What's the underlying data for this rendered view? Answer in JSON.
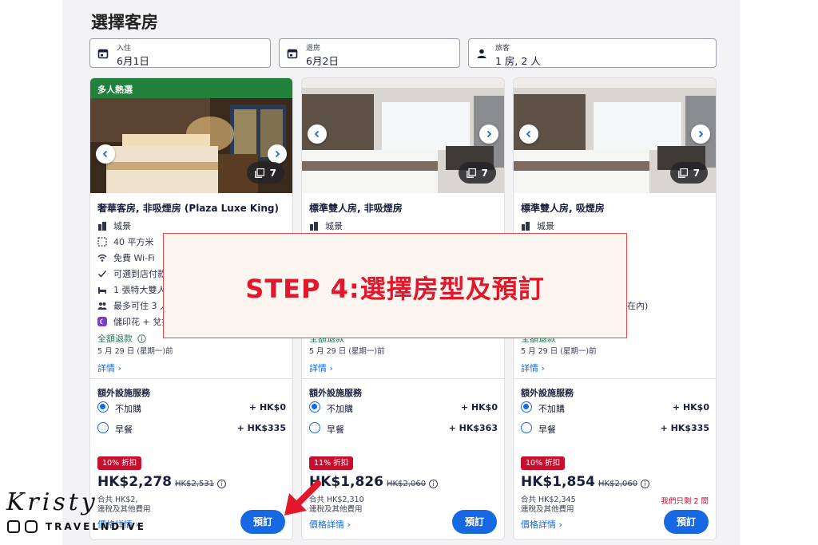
{
  "page_title": "選擇客房",
  "search": {
    "checkin": {
      "label": "入住",
      "value": "6月1日"
    },
    "checkout": {
      "label": "退房",
      "value": "6月2日"
    },
    "guests": {
      "label": "旅客",
      "value": "1 房, 2 人"
    }
  },
  "rooms": [
    {
      "badge": "多人熱選",
      "photo_count": "7",
      "name": "奢華客房, 非吸煙房 (Plaza Luxe King)",
      "features": [
        "城景",
        "40 平方米",
        "免費 Wi-Fi",
        "可選到店付款",
        "1 張特大雙人",
        "最多可住 3 人",
        "儲印花 + 兌換"
      ],
      "refund": "全額退款",
      "refund_date": "5 月 29 日 (星期一)前",
      "details": "詳情",
      "extras_title": "額外設施服務",
      "options": [
        {
          "label": "不加購",
          "price": "+ HK$0",
          "selected": true
        },
        {
          "label": "早餐",
          "price": "+ HK$335",
          "selected": false
        }
      ],
      "discount": "10% 折扣",
      "price": "HK$2,278",
      "original_price": "HK$2,531",
      "total": "合共 HK$2,  ",
      "tax_note": "連稅及其他費用",
      "scarcity": "",
      "price_details": "價格詳情",
      "book": "預訂"
    },
    {
      "badge": "",
      "photo_count": "7",
      "name": "標準雙人房, 非吸煙房",
      "features": [
        "城景"
      ],
      "refund": "全額退款",
      "refund_date": "5 月 29 日 (星期一)前",
      "details": "詳情",
      "extras_title": "額外設施服務",
      "options": [
        {
          "label": "不加購",
          "price": "+ HK$0",
          "selected": true
        },
        {
          "label": "早餐",
          "price": "+ HK$363",
          "selected": false
        }
      ],
      "discount": "11% 折扣",
      "price": "HK$1,826",
      "original_price": "HK$2,060",
      "total": "合共 HK$2,310",
      "tax_note": "連稅及其他費用",
      "scarcity": "",
      "price_details": "價格詳情",
      "book": "預訂"
    },
    {
      "badge": "",
      "photo_count": "7",
      "name": "標準雙人房, 吸煙房",
      "features": [
        "城景"
      ],
      "partial_note": "在內)",
      "refund": "全額退款",
      "refund_date": "5 月 29 日 (星期一)前",
      "details": "詳情",
      "extras_title": "額外設施服務",
      "options": [
        {
          "label": "不加購",
          "price": "+ HK$0",
          "selected": true
        },
        {
          "label": "早餐",
          "price": "+ HK$335",
          "selected": false
        }
      ],
      "discount": "10% 折扣",
      "price": "HK$1,854",
      "original_price": "HK$2,060",
      "total": "合共 HK$2,345",
      "tax_note": "連稅及其他費用",
      "scarcity": "我們只剩 2 間",
      "price_details": "價格詳情",
      "book": "預訂"
    }
  ],
  "overlay": {
    "text": "STEP 4:選擇房型及預訂"
  },
  "watermark": {
    "signature": "Kristy",
    "brand": "TRAVELNDIVE"
  },
  "colors": {
    "accent": "#1668e3",
    "badge_green": "#22823c",
    "discount_red": "#c8102e",
    "overlay_red": "#e3162b"
  }
}
